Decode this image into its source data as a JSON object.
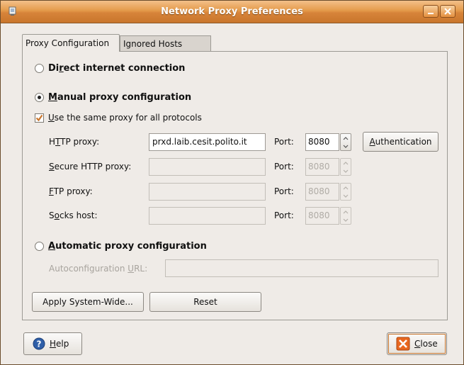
{
  "window": {
    "title": "Network Proxy Preferences"
  },
  "tabs": [
    {
      "label": "Proxy Configuration",
      "active": true
    },
    {
      "label": "Ignored Hosts",
      "active": false
    }
  ],
  "options": {
    "direct": {
      "pre": "Di",
      "key": "r",
      "post": "ect internet connection",
      "selected": false
    },
    "manual": {
      "pre": "",
      "key": "M",
      "post": "anual proxy configuration",
      "selected": true
    },
    "automatic": {
      "pre": "",
      "key": "A",
      "post": "utomatic proxy configuration",
      "selected": false
    }
  },
  "same_proxy": {
    "pre": "",
    "key": "U",
    "post": "se the same proxy for all protocols",
    "checked": true
  },
  "proxies": [
    {
      "pre": "H",
      "key": "T",
      "post": "TP proxy:",
      "host": "prxd.laib.cesit.polito.it",
      "port_label": "Port:",
      "port": "8080",
      "enabled": true
    },
    {
      "pre": "",
      "key": "S",
      "post": "ecure HTTP proxy:",
      "host": "",
      "port_label": "Port:",
      "port": "8080",
      "enabled": false
    },
    {
      "pre": "",
      "key": "F",
      "post": "TP proxy:",
      "host": "",
      "port_label": "Port:",
      "port": "8080",
      "enabled": false
    },
    {
      "pre": "S",
      "key": "o",
      "post": "cks host:",
      "host": "",
      "port_label": "Port:",
      "port": "8080",
      "enabled": false
    }
  ],
  "authentication": {
    "pre": "",
    "key": "A",
    "post": "uthentication"
  },
  "autoconfig": {
    "pre": "Autoconfiguration ",
    "key": "U",
    "post": "RL:",
    "value": ""
  },
  "buttons": {
    "apply": "Apply System-Wide...",
    "reset": "Reset",
    "help": {
      "pre": "",
      "key": "H",
      "post": "elp"
    },
    "close": {
      "pre": "",
      "key": "C",
      "post": "lose"
    }
  },
  "colors": {
    "title_bar": "#d7843a",
    "close_icon": "#e8671f",
    "help_icon": "#2f5fa8"
  },
  "icons": [
    "window-menu-icon",
    "minimize-icon",
    "close-icon",
    "help-icon",
    "close-x-icon",
    "spin-up-icon",
    "spin-down-icon"
  ]
}
